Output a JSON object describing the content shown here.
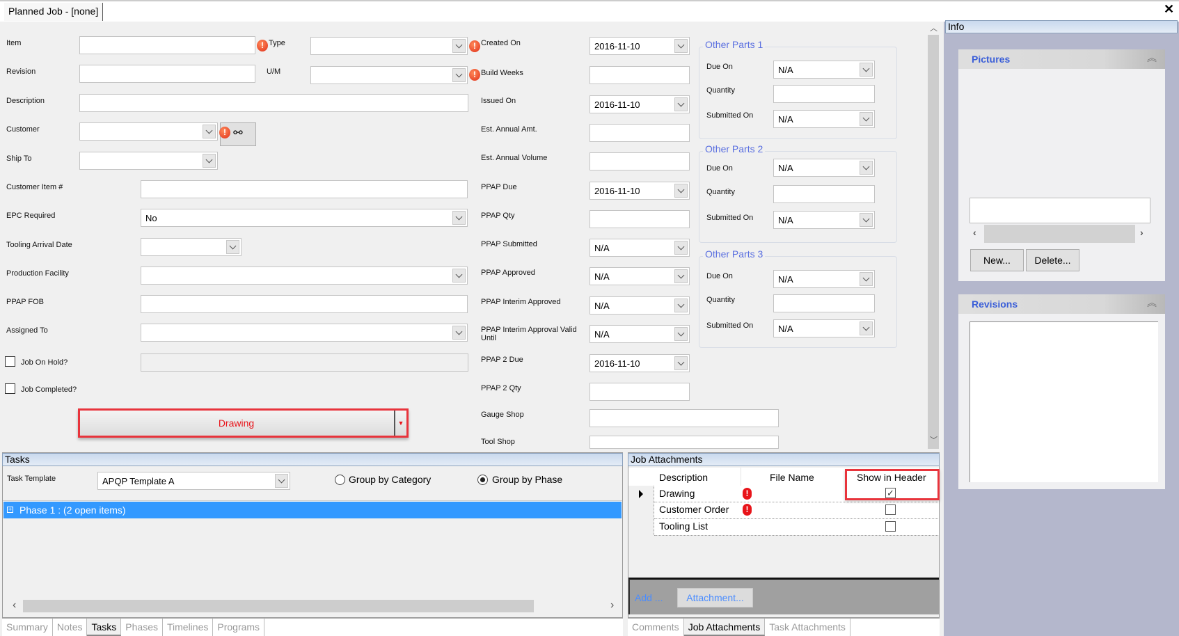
{
  "tab": {
    "title": "Planned Job - [none]",
    "close_icon": "close-icon"
  },
  "left": {
    "item": "Item",
    "revision": "Revision",
    "description": "Description",
    "customer": "Customer",
    "ship_to": "Ship To",
    "customer_item": "Customer Item #",
    "epc_required": "EPC Required",
    "epc_value": "No",
    "tooling_arrival": "Tooling Arrival Date",
    "production_facility": "Production Facility",
    "ppap_fob": "PPAP FOB",
    "assigned_to": "Assigned To",
    "job_on_hold": "Job On Hold?",
    "job_completed": "Job Completed?",
    "type": "Type",
    "um": "U/M",
    "drawing_button": "Drawing"
  },
  "middle": {
    "created_on": "Created On",
    "created_on_value": "2016-11-10",
    "build_weeks": "Build Weeks",
    "issued_on": "Issued On",
    "issued_on_value": "2016-11-10",
    "est_annual_amt": "Est. Annual Amt.",
    "est_annual_volume": "Est. Annual Volume",
    "ppap_due": "PPAP Due",
    "ppap_due_value": "2016-11-10",
    "ppap_qty": "PPAP Qty",
    "ppap_submitted": "PPAP Submitted",
    "ppap_submitted_value": "N/A",
    "ppap_approved": "PPAP Approved",
    "ppap_approved_value": "N/A",
    "ppap_interim_approved": "PPAP Interim Approved",
    "ppap_interim_approved_value": "N/A",
    "ppap_interim_valid": "PPAP Interim Approval Valid Until",
    "ppap_interim_valid_value": "N/A",
    "ppap2_due": "PPAP 2 Due",
    "ppap2_due_value": "2016-11-10",
    "ppap2_qty": "PPAP 2 Qty",
    "gauge_shop": "Gauge Shop",
    "tool_shop": "Tool Shop"
  },
  "other_parts": [
    {
      "title": "Other Parts 1",
      "due_on": "Due On",
      "due_on_value": "N/A",
      "quantity": "Quantity",
      "submitted_on": "Submitted On",
      "submitted_on_value": "N/A"
    },
    {
      "title": "Other Parts 2",
      "due_on": "Due On",
      "due_on_value": "N/A",
      "quantity": "Quantity",
      "submitted_on": "Submitted On",
      "submitted_on_value": "N/A"
    },
    {
      "title": "Other Parts 3",
      "due_on": "Due On",
      "due_on_value": "N/A",
      "quantity": "Quantity",
      "submitted_on": "Submitted On",
      "submitted_on_value": "N/A"
    }
  ],
  "info": {
    "title": "Info",
    "pictures": "Pictures",
    "new_button": "New...",
    "delete_button": "Delete...",
    "revisions": "Revisions"
  },
  "tasks": {
    "title": "Tasks",
    "template_label": "Task Template",
    "template_value": "APQP Template A",
    "group_by_category": "Group by Category",
    "group_by_phase": "Group by Phase",
    "selected_group": "Group by Phase",
    "phase_row": "Phase 1 : (2 open items)",
    "tabs": [
      "Summary",
      "Notes",
      "Tasks",
      "Phases",
      "Timelines",
      "Programs"
    ],
    "active_tab": "Tasks"
  },
  "attachments": {
    "title": "Job Attachments",
    "columns": [
      "Description",
      "File Name",
      "Show in Header"
    ],
    "rows": [
      {
        "description": "Drawing",
        "show_in_header": true,
        "missing_file": true
      },
      {
        "description": "Customer Order",
        "show_in_header": false,
        "missing_file": true
      },
      {
        "description": "Tooling List",
        "show_in_header": false,
        "missing_file": false
      }
    ],
    "add_label": "Add ...",
    "attachment_button": "Attachment...",
    "tabs": [
      "Comments",
      "Job Attachments",
      "Task Attachments"
    ],
    "active_tab": "Job Attachments"
  },
  "colors": {
    "accent_blue": "#3399ff",
    "highlight_red": "#e8343c",
    "group_title": "#5a6fe0",
    "info_bg": "#b4b7cc"
  }
}
